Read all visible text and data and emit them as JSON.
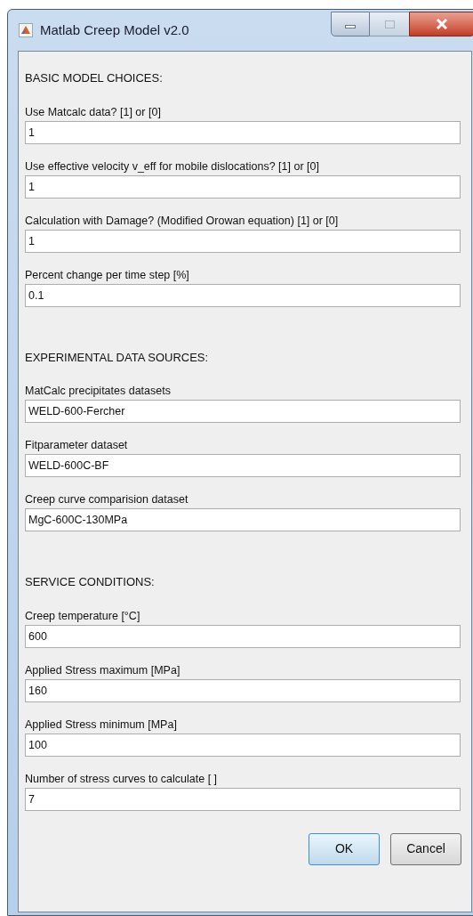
{
  "window": {
    "title": "Matlab Creep Model v2.0"
  },
  "items": [
    {
      "kind": "heading",
      "text": "BASIC MODEL CHOICES:"
    },
    {
      "kind": "field",
      "label": "Use Matcalc data? [1] or [0]",
      "value": "1"
    },
    {
      "kind": "field",
      "label": "Use effective velocity v_eff for mobile dislocations? [1] or [0]",
      "value": "1"
    },
    {
      "kind": "field",
      "label": "Calculation with Damage? (Modified Orowan equation) [1] or [0]",
      "value": "1"
    },
    {
      "kind": "field",
      "label": "Percent change per time step [%]",
      "value": "0.1"
    },
    {
      "kind": "heading",
      "text": "EXPERIMENTAL DATA SOURCES:"
    },
    {
      "kind": "field",
      "label": "MatCalc precipitates datasets",
      "value": "WELD-600-Fercher"
    },
    {
      "kind": "field",
      "label": "Fitparameter dataset",
      "value": "WELD-600C-BF"
    },
    {
      "kind": "field",
      "label": "Creep curve comparision dataset",
      "value": "MgC-600C-130MPa"
    },
    {
      "kind": "heading",
      "text": "SERVICE CONDITIONS:"
    },
    {
      "kind": "field",
      "label": "Creep temperature [°C]",
      "value": "600"
    },
    {
      "kind": "field",
      "label": "Applied Stress maximum [MPa]",
      "value": "160"
    },
    {
      "kind": "field",
      "label": "Applied Stress minimum [MPa]",
      "value": "100"
    },
    {
      "kind": "field",
      "label": "Number of stress curves to calculate [ ]",
      "value": "7"
    }
  ],
  "buttons": [
    "OK",
    "Cancel"
  ]
}
